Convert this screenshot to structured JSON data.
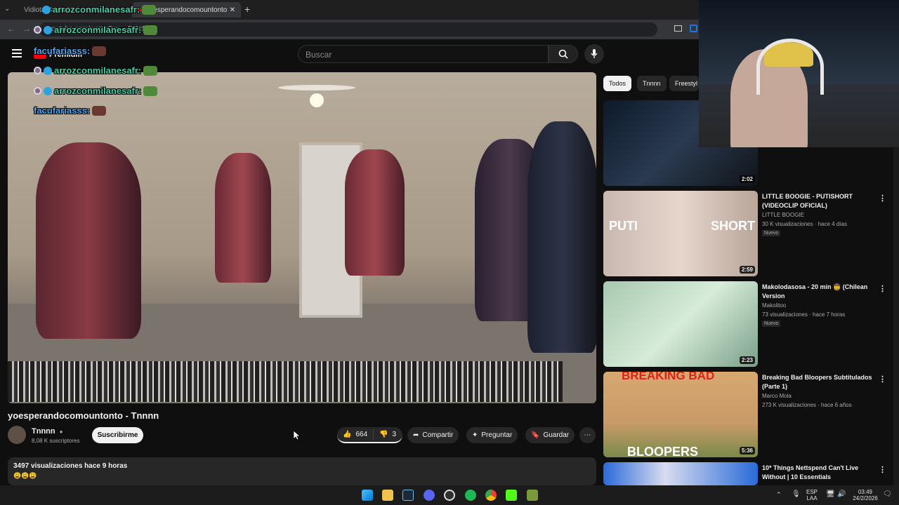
{
  "browser": {
    "tabs": [
      {
        "label": "Vidiota Ya La Sed"
      },
      {
        "label": "yoesperandocomountonto"
      }
    ],
    "url": "youtube.com/watch?v=...-DQz5U"
  },
  "header": {
    "premium_label": "Premium",
    "search_placeholder": "Buscar"
  },
  "video": {
    "title": "yoesperandocomountonto - Tnnnn",
    "channel": "Tnnnn",
    "subscribers": "8,08 K suscriptores",
    "subscribe_label": "Suscribirme",
    "likes": "664",
    "dislikes": "3",
    "share_label": "Compartir",
    "ask_label": "Preguntar",
    "save_label": "Guardar",
    "views_time": "3497 visualizaciones  hace 9 horas",
    "emojis": "😩😩😩"
  },
  "chips": [
    "Todos",
    "Tnnnn",
    "Freestyl"
  ],
  "recommended": [
    {
      "title": "",
      "channel": "",
      "stats": "",
      "badge": "",
      "duration": "2:02"
    },
    {
      "title": "LITTLE BOOGIE - PUTISHORT (VIDEOCLIP OFICIAL)",
      "channel": "LITTLE BOOGIE",
      "stats": "30 K visualizaciones · hace 4 días",
      "badge": "Nuevo",
      "duration": "2:59",
      "thumb_text_left": "PUTI",
      "thumb_text_right": "SHORT"
    },
    {
      "title": "Makolodasosa - 20 min 🤠 (Chilean Version",
      "channel": "Makolitoo",
      "stats": "73 visualizaciones · hace 7 horas",
      "badge": "Nuevo",
      "duration": "2:23"
    },
    {
      "title": "Breaking Bad Bloopers Subtitulados (Parte 1)",
      "channel": "Marco Mola",
      "stats": "273 K visualizaciones · hace 6 años",
      "badge": "",
      "duration": "5:36",
      "thumb_text_top": "BREAKING BAD",
      "thumb_text_bottom": "BLOOPERS"
    },
    {
      "title": "10* Things Nettspend Can't Live Without | 10 Essentials",
      "channel": "",
      "stats": "",
      "badge": "",
      "duration": ""
    }
  ],
  "chat": [
    {
      "user": "arrozconmilanesafr:",
      "color": "#3fd0a8"
    },
    {
      "user": "arrozconmilanesafr:",
      "color": "#3fd0a8"
    },
    {
      "user": "facufariasss:",
      "color": "#4aa8f0"
    },
    {
      "user": "arrozconmilanesafr:",
      "color": "#3fd0a8"
    },
    {
      "user": "arrozconmilanesafr:",
      "color": "#3fd0a8"
    },
    {
      "user": "facufariasss:",
      "color": "#4aa8f0"
    }
  ],
  "taskbar": {
    "lang_line1": "ESP",
    "lang_line2": "LAA",
    "time": "03:49",
    "date": "24/2/2026"
  },
  "colors": {
    "background": "#0f0f0f",
    "accent_red": "#ff0000",
    "text": "#f1f1f1"
  }
}
